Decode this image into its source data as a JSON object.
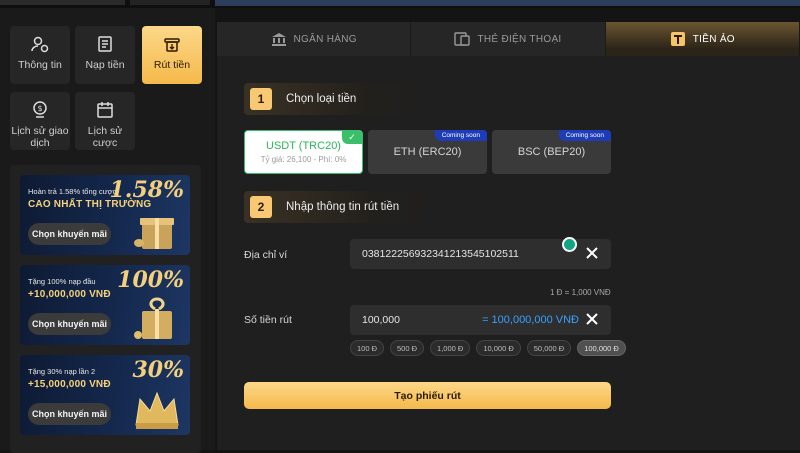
{
  "sidebar": {
    "items": [
      {
        "label": "Thông tin",
        "icon": "user-gear-icon"
      },
      {
        "label": "Nạp tiền",
        "icon": "deposit-icon"
      },
      {
        "label": "Rút tiền",
        "icon": "withdraw-icon",
        "active": true
      },
      {
        "label": "Lịch sử giao dịch",
        "icon": "transaction-history-icon"
      },
      {
        "label": "Lịch sử cược",
        "icon": "bet-history-icon"
      }
    ],
    "promos": [
      {
        "subtitle": "Hoàn trả 1.58% tổng cược",
        "headline": "CAO NHẤT THỊ TRƯỜNG",
        "big": "1.58%",
        "button": "Chọn khuyến mãi"
      },
      {
        "subtitle": "Tặng 100% nạp đầu",
        "headline": "+10,000,000 VNĐ",
        "big": "100%",
        "button": "Chọn khuyến mãi"
      },
      {
        "subtitle": "Tặng 30% nạp lần 2",
        "headline": "+15,000,000 VNĐ",
        "big": "30%",
        "button": "Chọn khuyến mãi"
      }
    ]
  },
  "tabs": [
    {
      "label": "NGÂN HÀNG",
      "icon": "bank-icon"
    },
    {
      "label": "THẺ ĐIỆN THOẠI",
      "icon": "phone-card-icon"
    },
    {
      "label": "TIỀN ẢO",
      "icon": "crypto-icon",
      "active": true
    }
  ],
  "step1": {
    "num": "1",
    "title": "Chọn loại tiền"
  },
  "coins": [
    {
      "name": "USDT (TRC20)",
      "rate": "Tỷ giá: 26,100 - Phí: 0%",
      "selected": true
    },
    {
      "name": "ETH (ERC20)",
      "badge": "Coming soon"
    },
    {
      "name": "BSC (BEP20)",
      "badge": "Coming soon"
    }
  ],
  "step2": {
    "num": "2",
    "title": "Nhập thông tin rút tiền"
  },
  "form": {
    "wallet_label": "Địa chỉ ví",
    "wallet_value": "038122256932341213545102511",
    "rate_info": "1 Đ = 1,000 VNĐ",
    "amount_label": "Số tiền rút",
    "amount_value": "100,000",
    "amount_converted": "= 100,000,000 VNĐ",
    "chips": [
      "100 Đ",
      "500 Đ",
      "1,000 Đ",
      "10,000 Đ",
      "50,000 Đ",
      "100,000 Đ"
    ],
    "selected_chip": "100,000 Đ",
    "submit": "Tạo phiếu rút"
  },
  "colors": {
    "accent": "#f5b94a",
    "selected": "#3cbf6a",
    "link": "#3aa0ff",
    "badge": "#1f3cb8"
  }
}
